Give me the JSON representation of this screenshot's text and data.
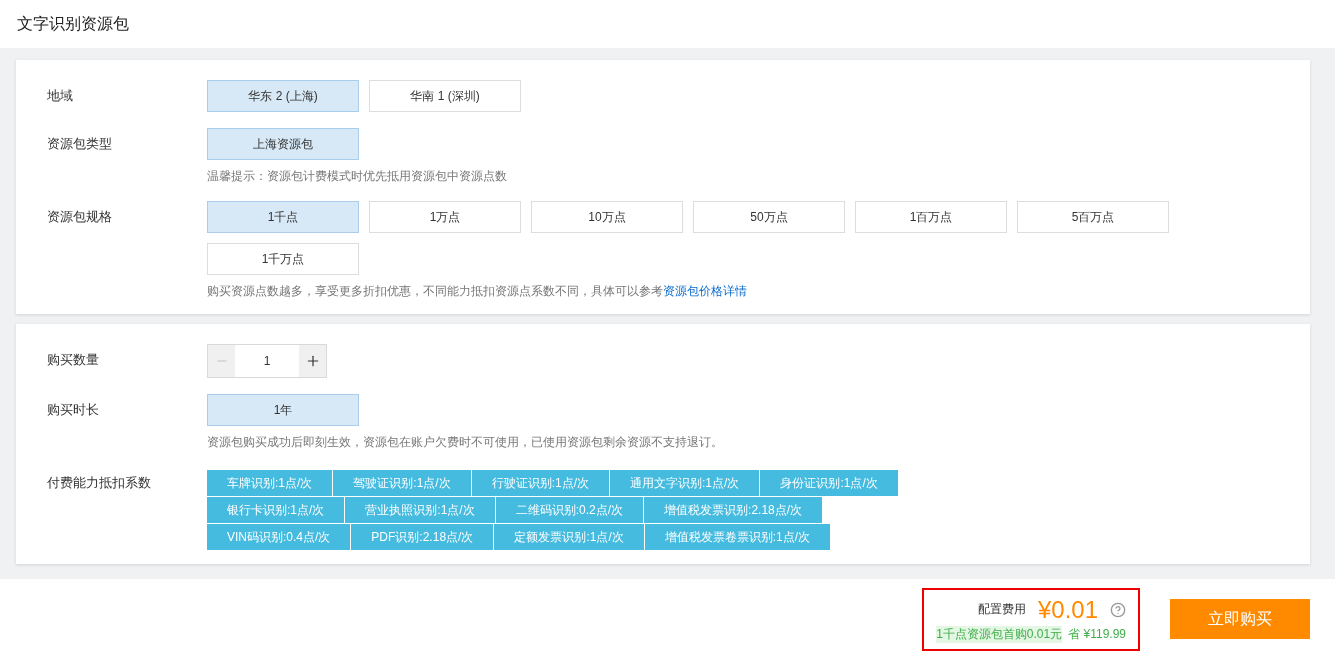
{
  "page_title": "文字识别资源包",
  "sections": [
    {
      "rows": [
        {
          "kind": "options",
          "label": "地域",
          "options": [
            {
              "label": "华东 2 (上海)",
              "selected": true
            },
            {
              "label": "华南 1 (深圳)",
              "selected": false
            }
          ]
        },
        {
          "kind": "options",
          "label": "资源包类型",
          "options": [
            {
              "label": "上海资源包",
              "selected": true
            }
          ],
          "hint": {
            "text": "温馨提示：资源包计费模式时优先抵用资源包中资源点数"
          }
        },
        {
          "kind": "options",
          "label": "资源包规格",
          "options": [
            {
              "label": "1千点",
              "selected": true
            },
            {
              "label": "1万点",
              "selected": false
            },
            {
              "label": "10万点",
              "selected": false
            },
            {
              "label": "50万点",
              "selected": false
            },
            {
              "label": "1百万点",
              "selected": false
            },
            {
              "label": "5百万点",
              "selected": false
            },
            {
              "label": "1千万点",
              "selected": false
            }
          ],
          "hint": {
            "text": "购买资源点数越多，享受更多折扣优惠，不同能力抵扣资源点系数不同，具体可以参考",
            "link": "资源包价格详情"
          }
        }
      ]
    },
    {
      "rows": [
        {
          "kind": "stepper",
          "label": "购买数量",
          "value": "1"
        },
        {
          "kind": "options",
          "label": "购买时长",
          "options": [
            {
              "label": "1年",
              "selected": true
            }
          ],
          "hint": {
            "text": "资源包购买成功后即刻生效，资源包在账户欠费时不可使用，已使用资源包剩余资源不支持退订。"
          }
        },
        {
          "kind": "tags",
          "label": "付费能力抵扣系数",
          "tags": [
            "车牌识别:1点/次",
            "驾驶证识别:1点/次",
            "行驶证识别:1点/次",
            "通用文字识别:1点/次",
            "身份证识别:1点/次",
            "银行卡识别:1点/次",
            "营业执照识别:1点/次",
            "二维码识别:0.2点/次",
            "增值税发票识别:2.18点/次",
            "VIN码识别:0.4点/次",
            "PDF识别:2.18点/次",
            "定额发票识别:1点/次",
            "增值税发票卷票识别:1点/次"
          ]
        }
      ]
    }
  ],
  "footer": {
    "cost_label": "配置费用",
    "price": "¥0.01",
    "promo": "1千点资源包首购0.01元",
    "saving": "省 ¥119.99",
    "buy_button": "立即购买"
  }
}
